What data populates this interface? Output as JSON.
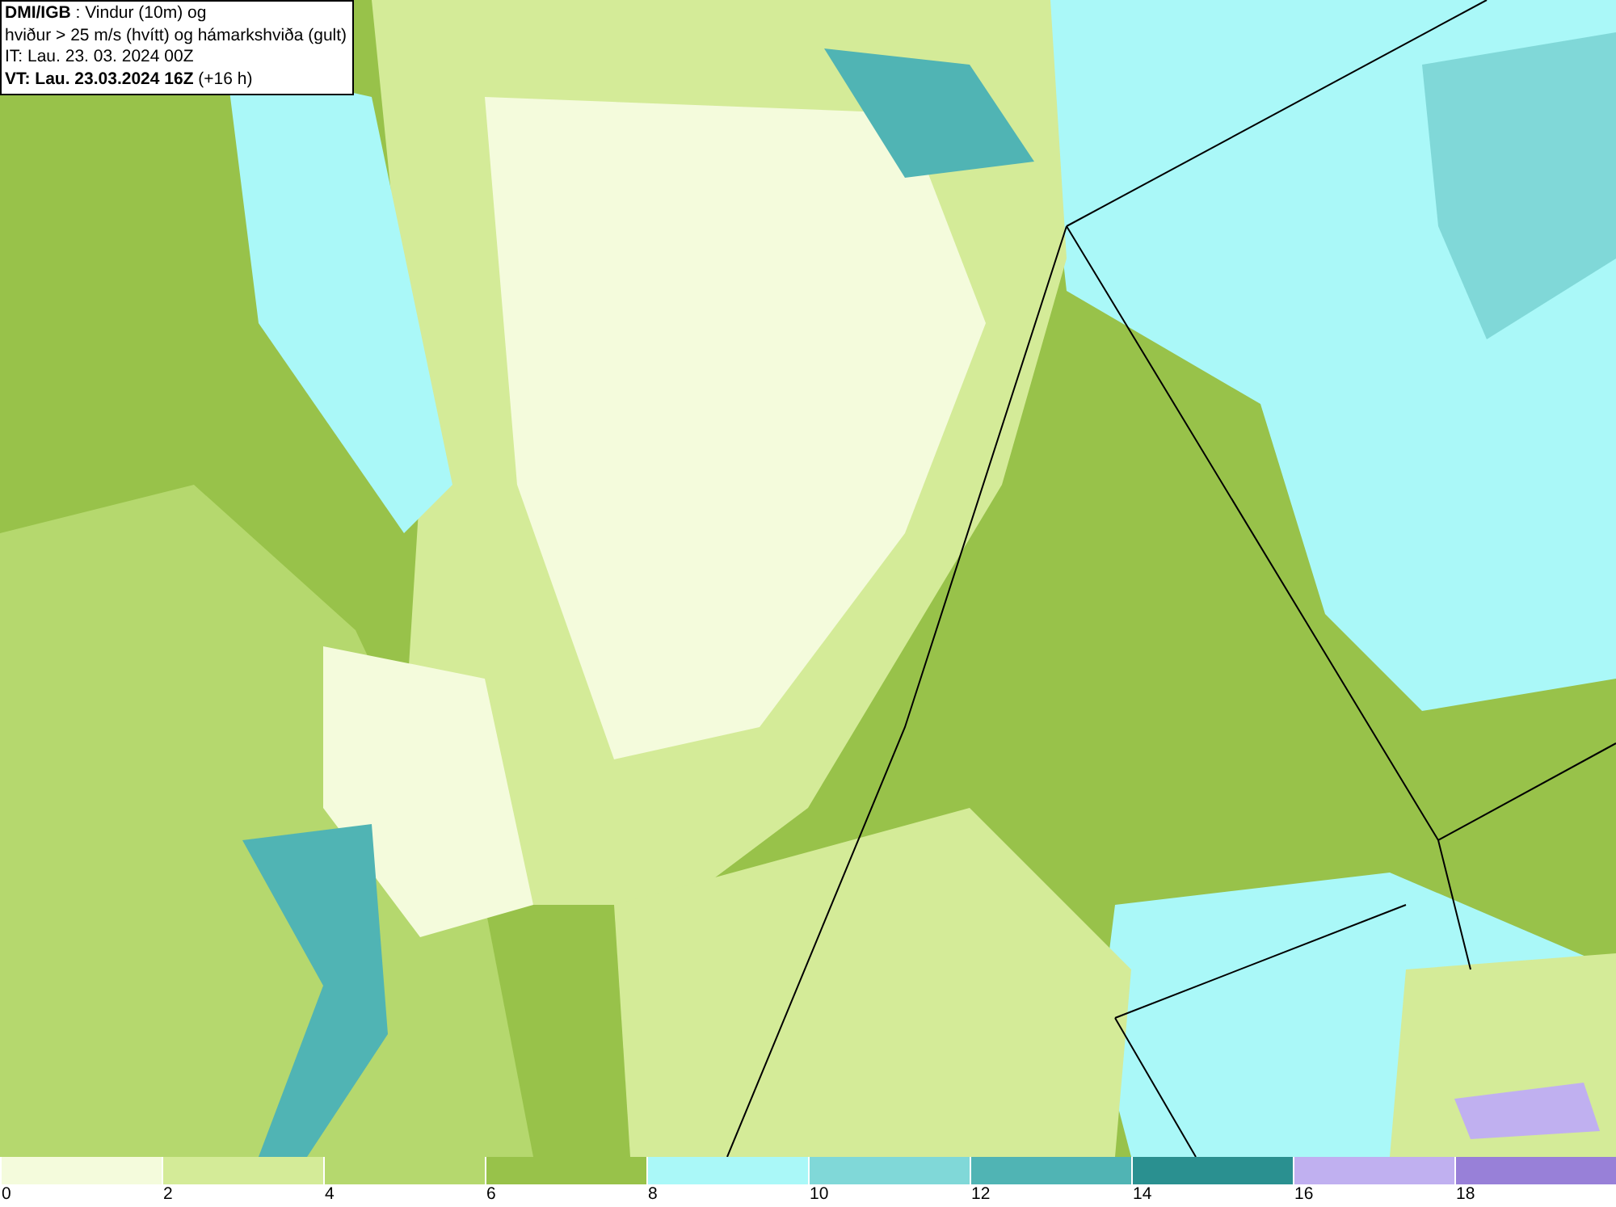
{
  "info_box": {
    "lines": [
      "**DMI/IGB** : Vindur (10m) og",
      "hviður > 25 m/s (hvítt) og hámarkshviða (gult)",
      "IT: Lau. 23. 03. 2024 00Z",
      "**VT: Lau. 23.03.2024 16Z** (+16 h)"
    ]
  },
  "color_scale": {
    "bins": [
      {
        "color": "#f4fbdc",
        "label": "0"
      },
      {
        "color": "#d4eb98",
        "label": "2"
      },
      {
        "color": "#b5d86e",
        "label": "4"
      },
      {
        "color": "#98c24a",
        "label": "6"
      },
      {
        "color": "#aaf8f8",
        "label": "8"
      },
      {
        "color": "#80d8d8",
        "label": "10"
      },
      {
        "color": "#50b4b4",
        "label": "12"
      },
      {
        "color": "#2a9090",
        "label": "14"
      },
      {
        "color": "#c0b0f0",
        "label": "16"
      },
      {
        "color": "#9880d8",
        "label": "18"
      }
    ]
  }
}
